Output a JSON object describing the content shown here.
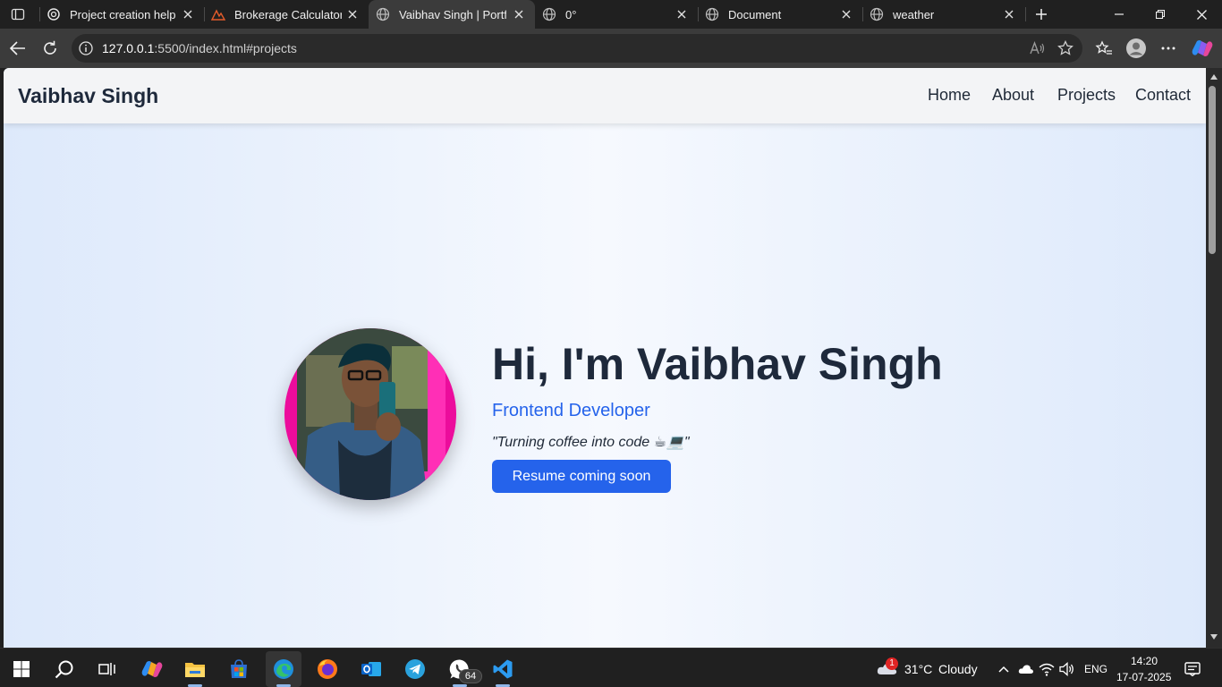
{
  "browser": {
    "tabs": [
      {
        "title": "Project creation help",
        "icon": "chatgpt-icon"
      },
      {
        "title": "Brokerage Calculator - Z",
        "icon": "zerodha-icon"
      },
      {
        "title": "Vaibhav Singh | Portfolio",
        "icon": "globe-icon",
        "active": true
      },
      {
        "title": "0°",
        "icon": "globe-icon"
      },
      {
        "title": "Document",
        "icon": "globe-icon"
      },
      {
        "title": "weather",
        "icon": "globe-icon"
      }
    ],
    "address": {
      "host": "127.0.0.1",
      "rest": ":5500/index.html#projects"
    }
  },
  "site": {
    "brand": "Vaibhav Singh",
    "nav": [
      "Home",
      "About",
      "Projects",
      "Contact"
    ],
    "hero": {
      "title": "Hi, I'm Vaibhav Singh",
      "subtitle": "Frontend Developer",
      "quote": "\"Turning coffee into code ☕💻\"",
      "button": "Resume coming soon"
    }
  },
  "taskbar": {
    "weather_temp": "31°C",
    "weather_desc": "Cloudy",
    "weather_badge": "1",
    "language": "ENG",
    "time": "14:20",
    "date": "17-07-2025",
    "whatsapp_badge": "64"
  },
  "colors": {
    "accent": "#2563eb",
    "brand_text": "#1e293b",
    "avatar_frame": "#ec0c9c"
  }
}
